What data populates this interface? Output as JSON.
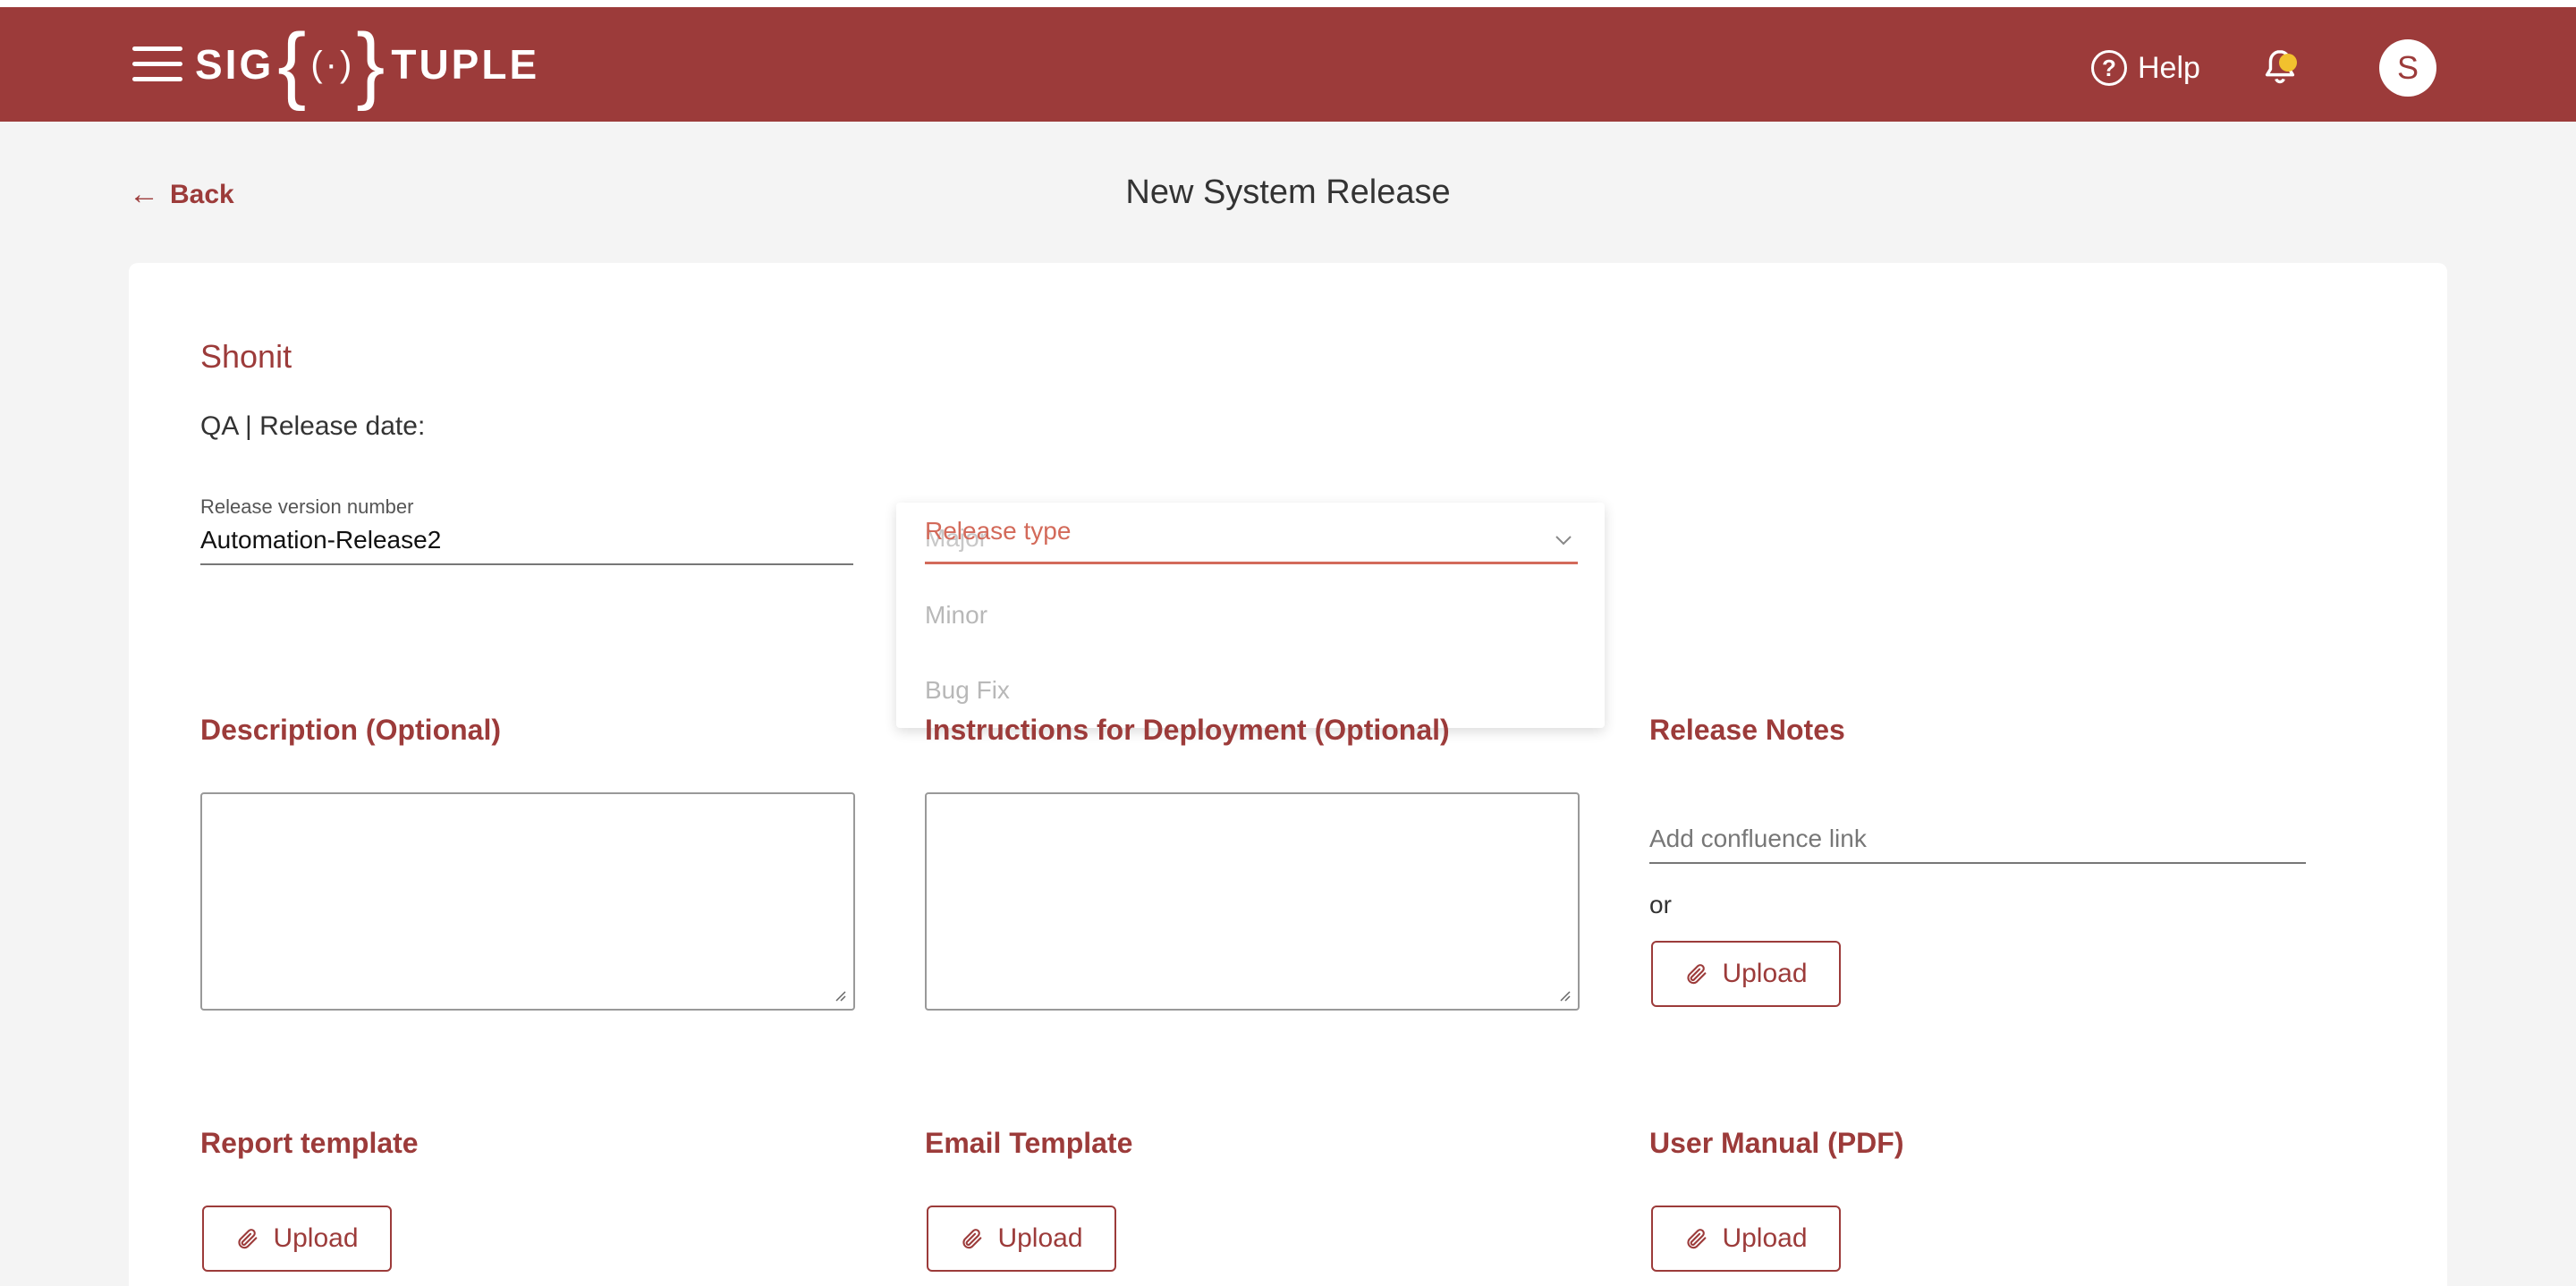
{
  "header": {
    "logo_left": "SIG",
    "logo_right": "TUPLE",
    "help_label": "Help",
    "avatar_initial": "S",
    "brand_color": "#9c3b3a"
  },
  "nav": {
    "back_label": "Back",
    "page_title": "New System Release"
  },
  "form": {
    "product_name": "Shonit",
    "qa_line": "QA | Release date:",
    "version_label": "Release version number",
    "version_value": "Automation-Release2",
    "release_type": {
      "label": "Release type",
      "options": [
        "Major",
        "Minor",
        "Bug Fix"
      ]
    },
    "description_title": "Description (Optional)",
    "instructions_title": "Instructions for Deployment (Optional)",
    "release_notes_title": "Release Notes",
    "confluence_placeholder": "Add confluence link",
    "or_text": "or",
    "upload_label": "Upload",
    "report_template_title": "Report template",
    "email_template_title": "Email Template",
    "user_manual_title": "User Manual (PDF)"
  },
  "icons": [
    "menu-icon",
    "help-icon",
    "bell-icon",
    "back-arrow-icon",
    "chevron-down-icon",
    "paperclip-icon",
    "resize-handle-icon"
  ]
}
